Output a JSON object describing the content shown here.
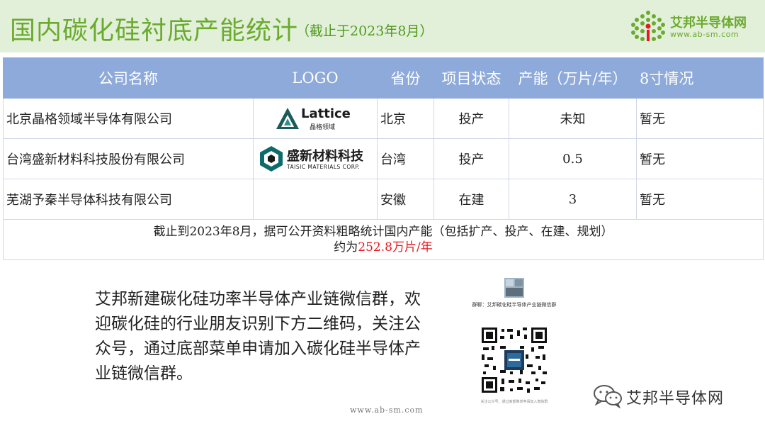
{
  "header": {
    "title": "国内碳化硅衬底产能统计",
    "subtitle": "（截止于2023年8月）",
    "brand_name": "艾邦半导体网",
    "brand_url": "www.ab-sm.com"
  },
  "table": {
    "columns": [
      "公司名称",
      "LOGO",
      "省份",
      "项目状态",
      "产能（万片/年）",
      "8寸情况"
    ],
    "rows": [
      {
        "company": "北京晶格领域半导体有限公司",
        "logo_text": "Lattice",
        "logo_sub": "晶格领域",
        "province": "北京",
        "status": "投产",
        "capacity": "未知",
        "eight_inch": "暂无"
      },
      {
        "company": "台湾盛新材料科技股份有限公司",
        "logo_text": "盛新材料科技",
        "logo_sub": "TAISIC MATERIALS CORP.",
        "province": "台湾",
        "status": "投产",
        "capacity": "0.5",
        "eight_inch": "暂无"
      },
      {
        "company": "芜湖予秦半导体科技有限公司",
        "logo_text": "",
        "logo_sub": "",
        "province": "安徽",
        "status": "在建",
        "capacity": "3",
        "eight_inch": "暂无"
      }
    ],
    "note_line1": "截止到2023年8月，据可公开资料粗略统计国内产能（包括扩产、投产、在建、规划）",
    "note_prefix": "约为",
    "note_value": "252.8万片/年"
  },
  "promo": {
    "text": "艾邦新建碳化硅功率半导体产业链微信群，欢迎碳化硅的行业朋友识别下方二维码，关注公众号，通过底部菜单申请加入碳化硅半导体产业链微信群。",
    "url": "www.ab-sm.com",
    "qr_title": "群聊：艾邦碳化硅半导体产业链微信群",
    "qr_footer": "关注公众号，通过底部菜单申请加入微信群"
  },
  "watermark": "艾邦半导体网",
  "colors": {
    "header_bg": "#e2efd9",
    "title_green": "#6aab2e",
    "table_header": "#8eaadb",
    "highlight_red": "#e8181d"
  }
}
